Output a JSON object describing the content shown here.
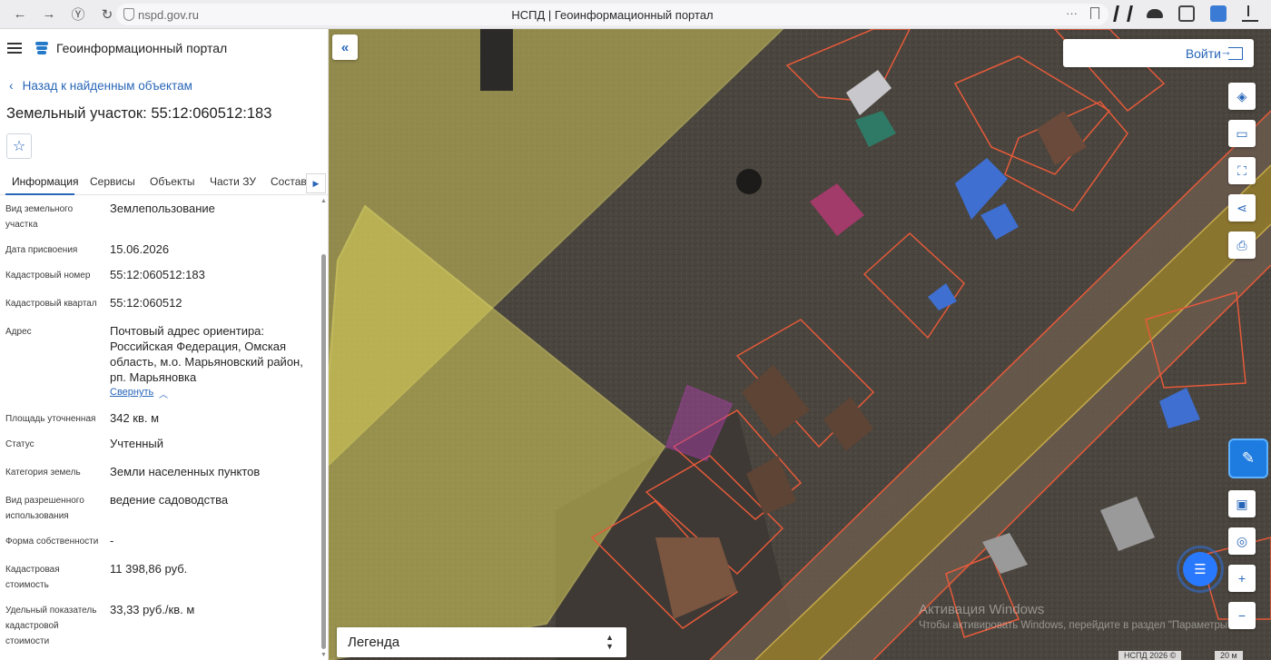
{
  "browser": {
    "url": "nspd.gov.ru",
    "tab_title": "НСПД | Геоинформационный портал",
    "more": "···"
  },
  "app": {
    "title": "Геоинформационный портал",
    "back_link": "Назад к найденным объектам",
    "parcel_title": "Земельный участок: 55:12:060512:183"
  },
  "tabs": [
    {
      "label": "Информация",
      "active": true
    },
    {
      "label": "Сервисы"
    },
    {
      "label": "Объекты"
    },
    {
      "label": "Части ЗУ"
    },
    {
      "label": "Состав"
    }
  ],
  "info": [
    {
      "label": "Вид земельного участка",
      "value": "Землепользование"
    },
    {
      "label": "Дата присвоения",
      "value": "15.06.2026"
    },
    {
      "label": "Кадастровый номер",
      "value": "55:12:060512:183"
    },
    {
      "label": "Кадастровый квартал",
      "value": "55:12:060512"
    },
    {
      "label": "Адрес",
      "value": "Почтовый адрес ориентира: Российская Федерация, Омская область, м.о. Марьяновский район, рп. Марьяновка"
    },
    {
      "label": "Площадь уточненная",
      "value": "342 кв. м"
    },
    {
      "label": "Статус",
      "value": "Учтенный"
    },
    {
      "label": "Категория земель",
      "value": "Земли населенных пунктов"
    },
    {
      "label": "Вид разрешенного использования",
      "value": "ведение садоводства"
    },
    {
      "label": "Форма собственности",
      "value": "-"
    },
    {
      "label": "Кадастровая стоимость",
      "value": "11 398,86 руб."
    },
    {
      "label": "Удельный показатель кадастровой стоимости",
      "value": "33,33 руб./кв. м"
    }
  ],
  "collapse_label": "Свернуть",
  "map": {
    "login_label": "Войти",
    "legend_label": "Легенда",
    "watermark_line1": "Активация Windows",
    "watermark_line2": "Чтобы активировать Windows, перейдите в раздел \"Параметры\".",
    "scale_left": "НСПД 2026 ©",
    "scale_right": "20 м",
    "colors": {
      "yellow_zone": "#e8e06a",
      "parcel_border": "#e65a3a",
      "selected_parcel": "#c040c0",
      "road_band": "#a8902a",
      "accent": "#2866b8"
    }
  }
}
